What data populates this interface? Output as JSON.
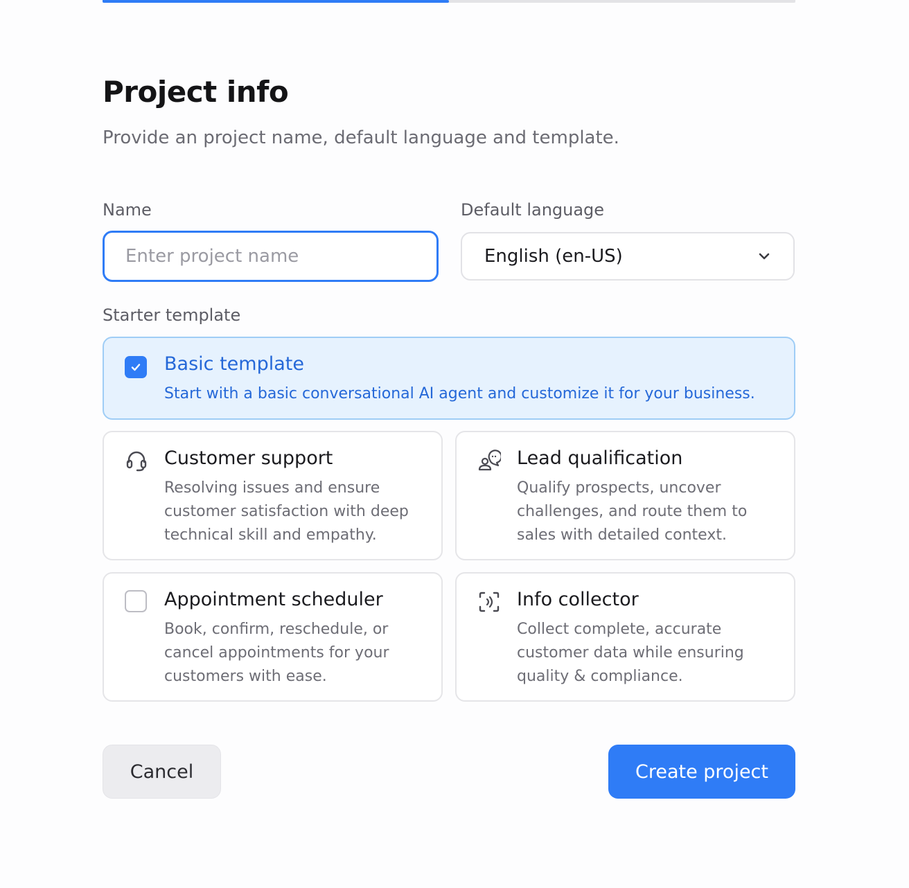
{
  "progress": {
    "fraction": 0.5
  },
  "header": {
    "title": "Project info",
    "subtitle": "Provide an project name, default language and template."
  },
  "form": {
    "name_label": "Name",
    "name_placeholder": "Enter project name",
    "name_value": "",
    "language_label": "Default language",
    "language_value": "English (en-US)",
    "template_label": "Starter template"
  },
  "templates": [
    {
      "title": "Basic template",
      "description": "Start with a basic conversational AI agent and customize it for your business.",
      "icon": "checkbox-checked",
      "selected": true
    },
    {
      "title": "Customer support",
      "description": [
        "Resolving issues and ensure",
        "customer satisfaction with deep",
        "technical skill and empathy."
      ],
      "icon": "headset-icon",
      "selected": false
    },
    {
      "title": "Lead qualification",
      "description": [
        "Qualify prospects, uncover",
        "challenges, and route them to",
        "sales with detailed context."
      ],
      "icon": "person-speaking-icon",
      "selected": false
    },
    {
      "title": "Appointment scheduler",
      "description": [
        "Book, confirm, reschedule, or",
        "cancel appointments for your",
        "customers with ease."
      ],
      "icon": "checkbox-unchecked",
      "selected": false
    },
    {
      "title": "Info collector",
      "description": [
        "Collect complete, accurate",
        "customer data while ensuring",
        "quality & compliance."
      ],
      "icon": "scan-voice-icon",
      "selected": false
    }
  ],
  "actions": {
    "cancel_label": "Cancel",
    "create_label": "Create project"
  },
  "colors": {
    "accent": "#2f7cf6",
    "selected_bg": "#e6f2fe",
    "selected_text": "#2568d8"
  }
}
